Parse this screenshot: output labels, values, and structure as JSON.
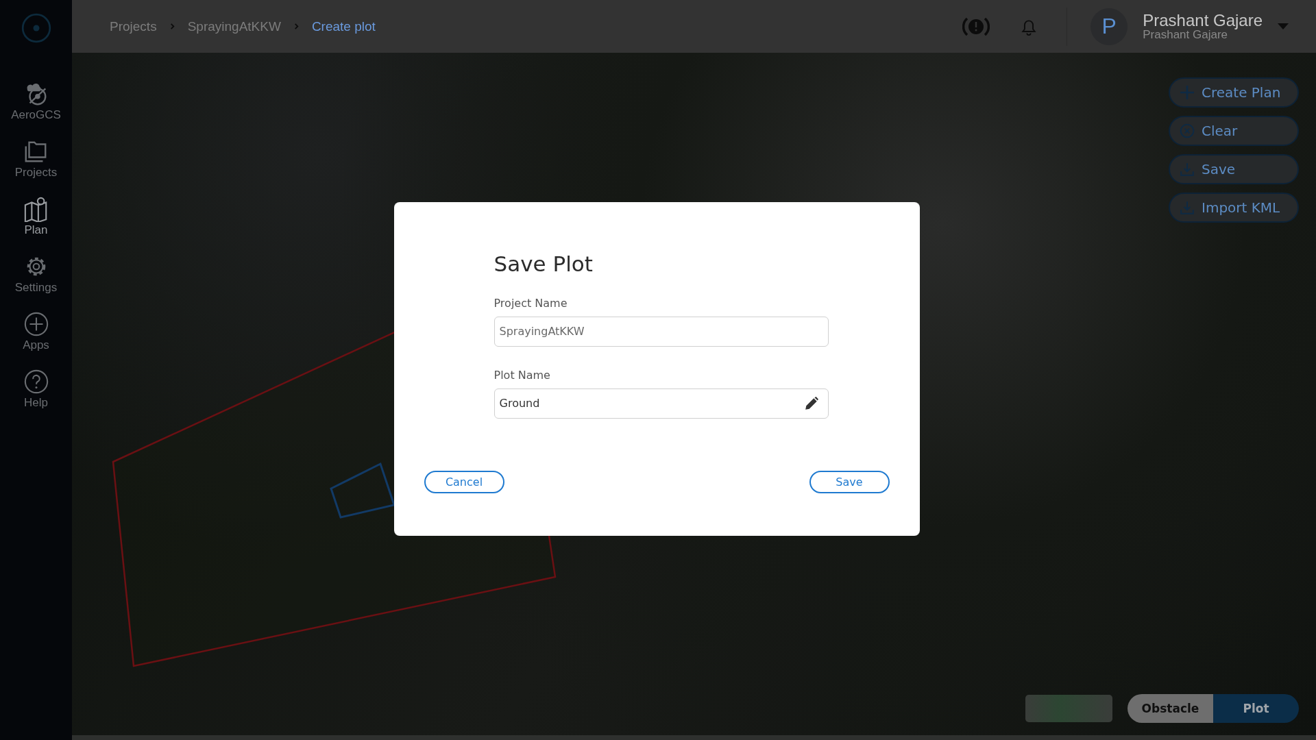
{
  "sidebar": {
    "items": [
      {
        "label": "AeroGCS",
        "kind": "logo",
        "selected": false
      },
      {
        "label": "Projects",
        "kind": "folder",
        "selected": false
      },
      {
        "label": "Plan",
        "kind": "map",
        "selected": true
      },
      {
        "label": "Settings",
        "kind": "gear",
        "selected": false
      },
      {
        "label": "Apps",
        "kind": "plus",
        "selected": false
      },
      {
        "label": "Help",
        "kind": "help",
        "selected": false
      }
    ]
  },
  "breadcrumb": [
    {
      "label": "Projects",
      "current": false
    },
    {
      "label": "SprayingAtKKW",
      "current": false
    },
    {
      "label": "Create plot",
      "current": true
    }
  ],
  "user": {
    "initial": "P",
    "name": "Prashant Gajare",
    "subtitle": "Prashant Gajare"
  },
  "map_actions": [
    {
      "label": "Create Plan",
      "kind": "plus"
    },
    {
      "label": "Clear",
      "kind": "clear"
    },
    {
      "label": "Save",
      "kind": "download"
    },
    {
      "label": "Import KML",
      "kind": "download"
    }
  ],
  "mode_toggle": [
    {
      "label": "Obstacle",
      "selected": false
    },
    {
      "label": "Plot",
      "selected": true
    }
  ],
  "dialog": {
    "title": "Save Plot",
    "fields": [
      {
        "label": "Project Name",
        "value": "SprayingAtKKW",
        "editable": false
      },
      {
        "label": "Plot Name",
        "value": "Ground",
        "editable": true
      }
    ],
    "buttons": [
      {
        "label": "Cancel"
      },
      {
        "label": "Save"
      }
    ]
  }
}
